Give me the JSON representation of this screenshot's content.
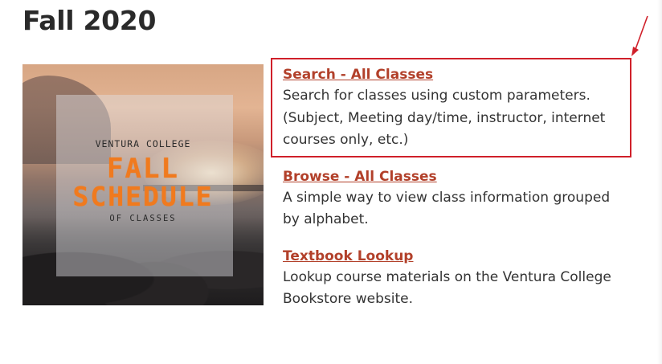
{
  "page": {
    "title": "Fall 2020"
  },
  "cover": {
    "college": "VENTURA COLLEGE",
    "line1": "FALL",
    "line2": "SCHEDULE",
    "line3": "OF CLASSES"
  },
  "entries": [
    {
      "link": "Search - All Classes",
      "description": "Search for classes using custom parameters. (Subject, Meeting day/time, instructor, internet courses only, etc.)"
    },
    {
      "link": "Browse - All Classes",
      "description": "A simple way to view class information grouped by alphabet."
    },
    {
      "link": "Textbook Lookup",
      "description": "Lookup course materials on the Ventura College Bookstore website."
    }
  ],
  "colors": {
    "link": "#b2402a",
    "highlight": "#d0202a",
    "cover_accent": "#f07a1e"
  }
}
